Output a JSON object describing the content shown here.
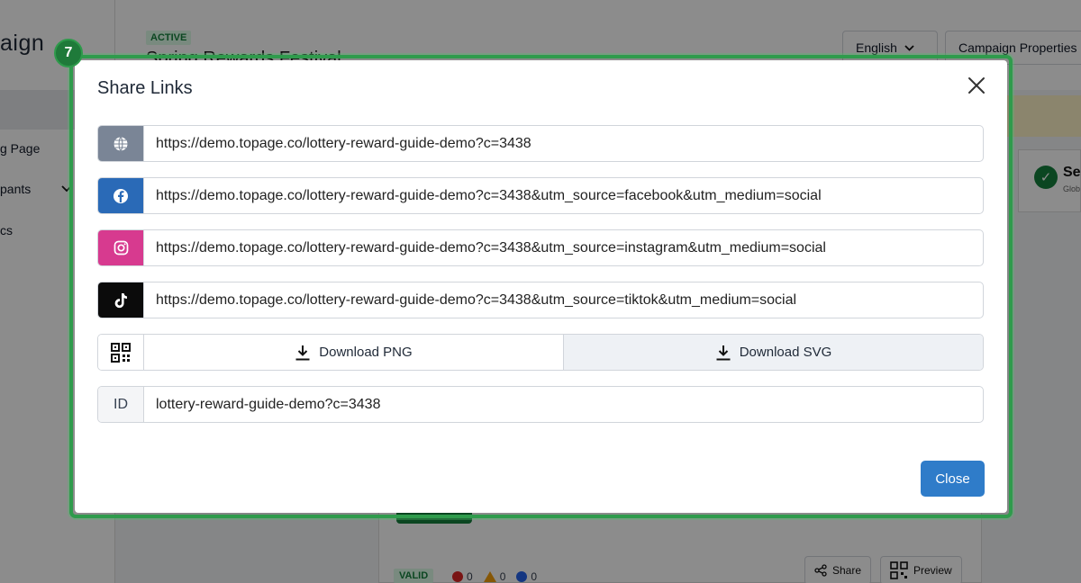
{
  "background": {
    "logo_text": "aign",
    "nav": [
      {
        "label": "g Page"
      },
      {
        "label": "pants"
      },
      {
        "label": "cs"
      }
    ],
    "status_badge": "ACTIVE",
    "campaign_title": "Spring Rewards Festival",
    "language_select": "English",
    "properties_button": "Campaign Properties",
    "card_title": "Se",
    "card_sub": "Glob",
    "valid_badge": "VALID",
    "error_count": "0",
    "warning_count": "0",
    "info_count": "0",
    "share_button": "Share",
    "preview_button": "Preview"
  },
  "step_number": "7",
  "modal": {
    "title": "Share Links",
    "links": [
      {
        "icon": "globe-icon",
        "url": "https://demo.topage.co/lottery-reward-guide-demo?c=3438"
      },
      {
        "icon": "facebook-icon",
        "url": "https://demo.topage.co/lottery-reward-guide-demo?c=3438&utm_source=facebook&utm_medium=social"
      },
      {
        "icon": "instagram-icon",
        "url": "https://demo.topage.co/lottery-reward-guide-demo?c=3438&utm_source=instagram&utm_medium=social"
      },
      {
        "icon": "tiktok-icon",
        "url": "https://demo.topage.co/lottery-reward-guide-demo?c=3438&utm_source=tiktok&utm_medium=social"
      }
    ],
    "download_png_label": "Download PNG",
    "download_svg_label": "Download SVG",
    "id_label": "ID",
    "id_value": "lottery-reward-guide-demo?c=3438",
    "close_label": "Close"
  },
  "colors": {
    "accent": "#2f7cc9",
    "highlight": "#2f9b4c",
    "facebook": "#2a6ab7",
    "instagram": "#d73a8f",
    "tiktok": "#0b0b0b",
    "globe": "#7a8596"
  }
}
